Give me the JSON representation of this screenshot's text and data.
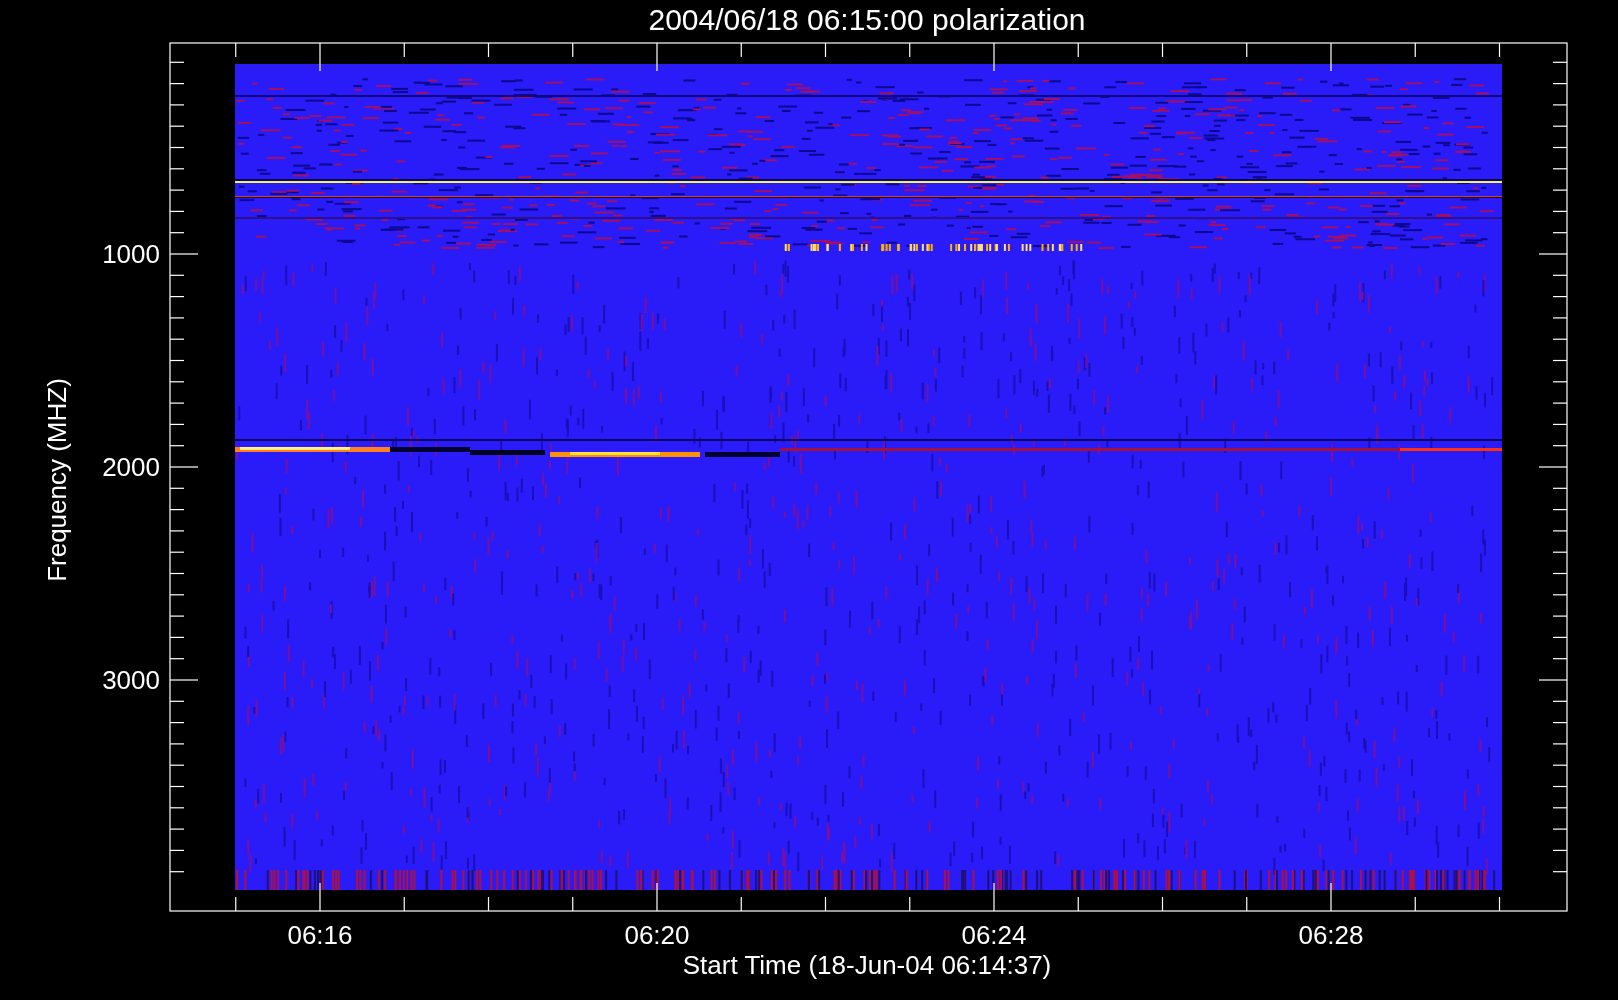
{
  "title": "2004/06/18 06:15:00 polarization",
  "x_axis": {
    "label": "Start Time (18-Jun-04 06:14:37)",
    "ticks": [
      "06:16",
      "06:20",
      "06:24",
      "06:28"
    ]
  },
  "y_axis": {
    "label": "Frequency (MHZ)",
    "ticks": [
      "1000",
      "2000",
      "3000"
    ]
  }
}
